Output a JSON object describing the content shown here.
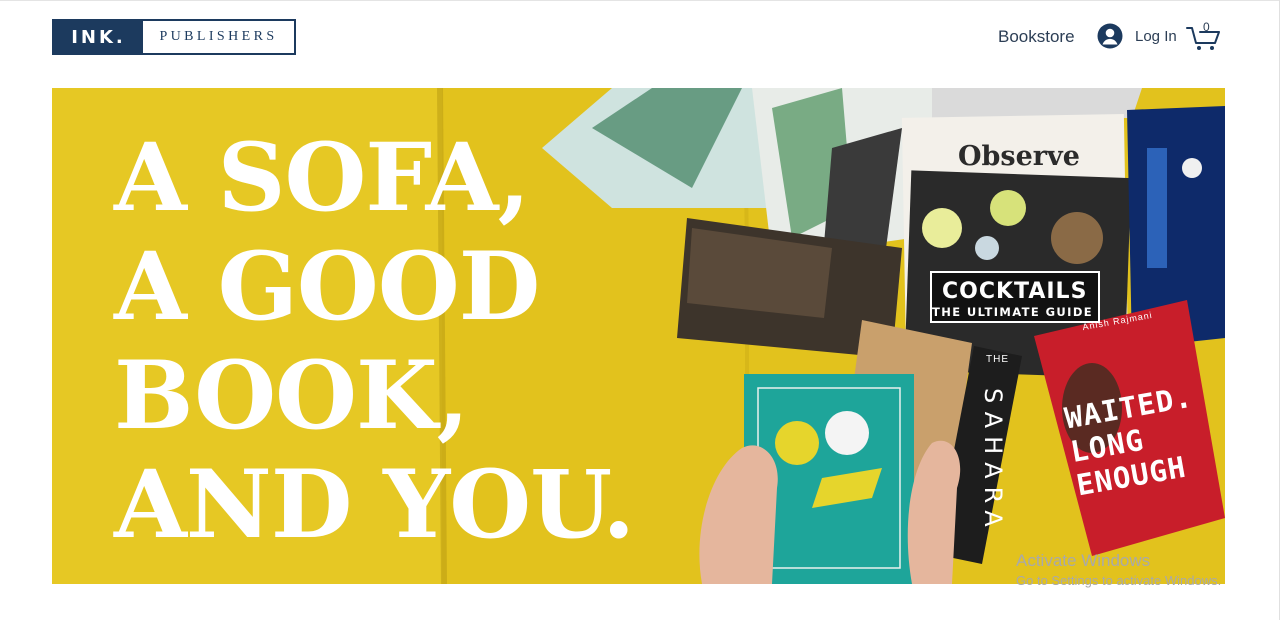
{
  "header": {
    "logo_left": "INK.",
    "logo_right": "PUBLISHERS",
    "nav_bookstore": "Bookstore",
    "login_label": "Log In",
    "cart_count": "0"
  },
  "hero": {
    "headline_lines": [
      "A SOFA,",
      "A GOOD",
      "BOOK,",
      "AND YOU."
    ],
    "books": {
      "observe": "Observe",
      "cocktails": "COCKTAILS",
      "cocktails_sub": "THE ULTIMATE GUIDE",
      "sahara_prefix": "THE",
      "sahara": "SAHARA",
      "author": "Anish Rajmani",
      "novel_lines": [
        "WAITED.",
        "LONG",
        "ENOUGH"
      ]
    }
  },
  "watermark": {
    "title": "Activate Windows",
    "subtitle": "Go to Settings to activate Windows."
  },
  "colors": {
    "brand_navy": "#1c3a5e",
    "hero_yellow": "#e2c21d",
    "text_dark": "#2c3e55"
  }
}
